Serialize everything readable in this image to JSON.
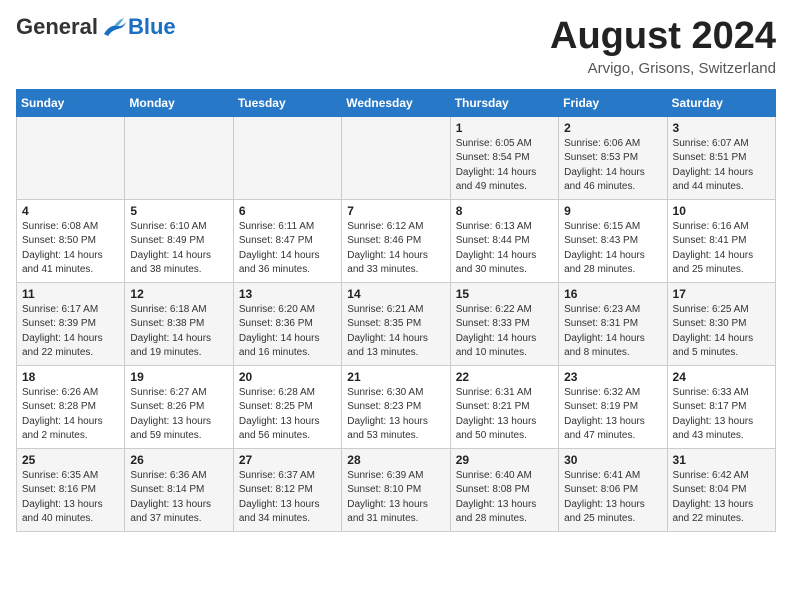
{
  "header": {
    "logo_general": "General",
    "logo_blue": "Blue",
    "month_year": "August 2024",
    "location": "Arvigo, Grisons, Switzerland"
  },
  "weekdays": [
    "Sunday",
    "Monday",
    "Tuesday",
    "Wednesday",
    "Thursday",
    "Friday",
    "Saturday"
  ],
  "weeks": [
    [
      {
        "day": "",
        "info": ""
      },
      {
        "day": "",
        "info": ""
      },
      {
        "day": "",
        "info": ""
      },
      {
        "day": "",
        "info": ""
      },
      {
        "day": "1",
        "info": "Sunrise: 6:05 AM\nSunset: 8:54 PM\nDaylight: 14 hours and 49 minutes."
      },
      {
        "day": "2",
        "info": "Sunrise: 6:06 AM\nSunset: 8:53 PM\nDaylight: 14 hours and 46 minutes."
      },
      {
        "day": "3",
        "info": "Sunrise: 6:07 AM\nSunset: 8:51 PM\nDaylight: 14 hours and 44 minutes."
      }
    ],
    [
      {
        "day": "4",
        "info": "Sunrise: 6:08 AM\nSunset: 8:50 PM\nDaylight: 14 hours and 41 minutes."
      },
      {
        "day": "5",
        "info": "Sunrise: 6:10 AM\nSunset: 8:49 PM\nDaylight: 14 hours and 38 minutes."
      },
      {
        "day": "6",
        "info": "Sunrise: 6:11 AM\nSunset: 8:47 PM\nDaylight: 14 hours and 36 minutes."
      },
      {
        "day": "7",
        "info": "Sunrise: 6:12 AM\nSunset: 8:46 PM\nDaylight: 14 hours and 33 minutes."
      },
      {
        "day": "8",
        "info": "Sunrise: 6:13 AM\nSunset: 8:44 PM\nDaylight: 14 hours and 30 minutes."
      },
      {
        "day": "9",
        "info": "Sunrise: 6:15 AM\nSunset: 8:43 PM\nDaylight: 14 hours and 28 minutes."
      },
      {
        "day": "10",
        "info": "Sunrise: 6:16 AM\nSunset: 8:41 PM\nDaylight: 14 hours and 25 minutes."
      }
    ],
    [
      {
        "day": "11",
        "info": "Sunrise: 6:17 AM\nSunset: 8:39 PM\nDaylight: 14 hours and 22 minutes."
      },
      {
        "day": "12",
        "info": "Sunrise: 6:18 AM\nSunset: 8:38 PM\nDaylight: 14 hours and 19 minutes."
      },
      {
        "day": "13",
        "info": "Sunrise: 6:20 AM\nSunset: 8:36 PM\nDaylight: 14 hours and 16 minutes."
      },
      {
        "day": "14",
        "info": "Sunrise: 6:21 AM\nSunset: 8:35 PM\nDaylight: 14 hours and 13 minutes."
      },
      {
        "day": "15",
        "info": "Sunrise: 6:22 AM\nSunset: 8:33 PM\nDaylight: 14 hours and 10 minutes."
      },
      {
        "day": "16",
        "info": "Sunrise: 6:23 AM\nSunset: 8:31 PM\nDaylight: 14 hours and 8 minutes."
      },
      {
        "day": "17",
        "info": "Sunrise: 6:25 AM\nSunset: 8:30 PM\nDaylight: 14 hours and 5 minutes."
      }
    ],
    [
      {
        "day": "18",
        "info": "Sunrise: 6:26 AM\nSunset: 8:28 PM\nDaylight: 14 hours and 2 minutes."
      },
      {
        "day": "19",
        "info": "Sunrise: 6:27 AM\nSunset: 8:26 PM\nDaylight: 13 hours and 59 minutes."
      },
      {
        "day": "20",
        "info": "Sunrise: 6:28 AM\nSunset: 8:25 PM\nDaylight: 13 hours and 56 minutes."
      },
      {
        "day": "21",
        "info": "Sunrise: 6:30 AM\nSunset: 8:23 PM\nDaylight: 13 hours and 53 minutes."
      },
      {
        "day": "22",
        "info": "Sunrise: 6:31 AM\nSunset: 8:21 PM\nDaylight: 13 hours and 50 minutes."
      },
      {
        "day": "23",
        "info": "Sunrise: 6:32 AM\nSunset: 8:19 PM\nDaylight: 13 hours and 47 minutes."
      },
      {
        "day": "24",
        "info": "Sunrise: 6:33 AM\nSunset: 8:17 PM\nDaylight: 13 hours and 43 minutes."
      }
    ],
    [
      {
        "day": "25",
        "info": "Sunrise: 6:35 AM\nSunset: 8:16 PM\nDaylight: 13 hours and 40 minutes."
      },
      {
        "day": "26",
        "info": "Sunrise: 6:36 AM\nSunset: 8:14 PM\nDaylight: 13 hours and 37 minutes."
      },
      {
        "day": "27",
        "info": "Sunrise: 6:37 AM\nSunset: 8:12 PM\nDaylight: 13 hours and 34 minutes."
      },
      {
        "day": "28",
        "info": "Sunrise: 6:39 AM\nSunset: 8:10 PM\nDaylight: 13 hours and 31 minutes."
      },
      {
        "day": "29",
        "info": "Sunrise: 6:40 AM\nSunset: 8:08 PM\nDaylight: 13 hours and 28 minutes."
      },
      {
        "day": "30",
        "info": "Sunrise: 6:41 AM\nSunset: 8:06 PM\nDaylight: 13 hours and 25 minutes."
      },
      {
        "day": "31",
        "info": "Sunrise: 6:42 AM\nSunset: 8:04 PM\nDaylight: 13 hours and 22 minutes."
      }
    ]
  ]
}
